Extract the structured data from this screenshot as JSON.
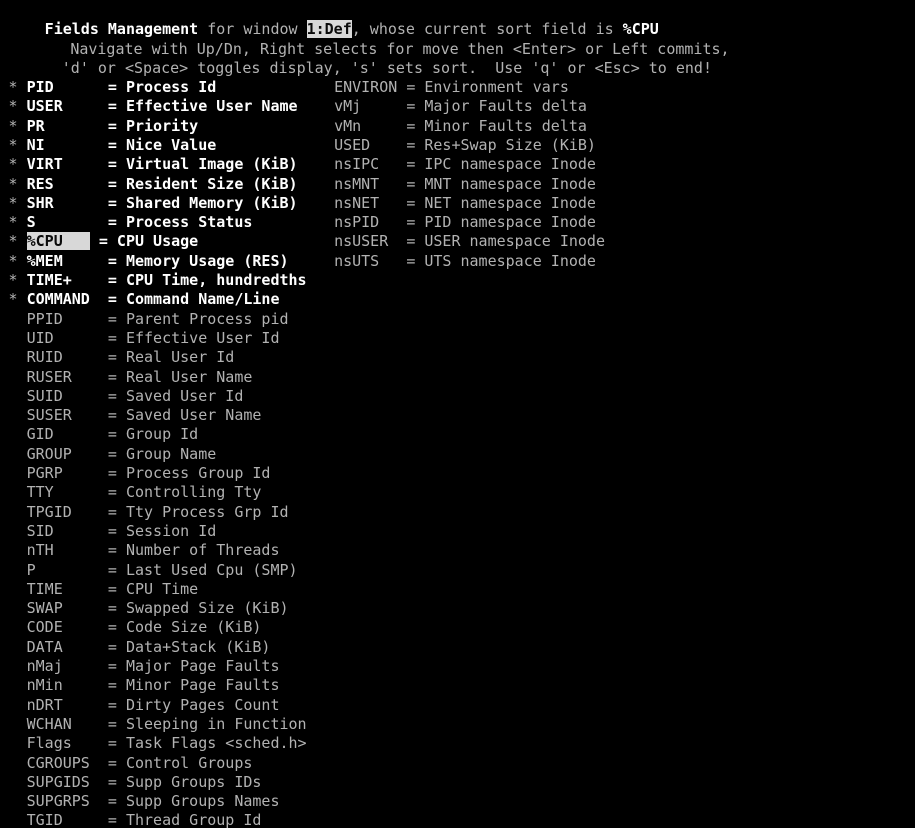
{
  "terminal": {
    "title": "Fields Management",
    "background_color": "#000000",
    "text_color": "#b2b2b2",
    "bold_color": "#ffffff",
    "highlight_bg": "#d8d8d8",
    "highlight_fg": "#0b0b0b"
  },
  "header": {
    "line1": {
      "title": "Fields Management",
      "for_window": " for window ",
      "window_value": "1:Def",
      "whose": ", whose current sort field is ",
      "sort_field": "%CPU"
    },
    "line2": "Navigate with Up/Dn, Right selects for move then <Enter> or Left commits,",
    "line3": "'d' or <Space> toggles display, 's' sets sort.  Use 'q' or <Esc> to end!"
  },
  "left_column": [
    {
      "marker": "*",
      "name": "PID",
      "desc": "Process Id",
      "on": true,
      "selected": false
    },
    {
      "marker": "*",
      "name": "USER",
      "desc": "Effective User Name",
      "on": true,
      "selected": false
    },
    {
      "marker": "*",
      "name": "PR",
      "desc": "Priority",
      "on": true,
      "selected": false
    },
    {
      "marker": "*",
      "name": "NI",
      "desc": "Nice Value",
      "on": true,
      "selected": false
    },
    {
      "marker": "*",
      "name": "VIRT",
      "desc": "Virtual Image (KiB)",
      "on": true,
      "selected": false
    },
    {
      "marker": "*",
      "name": "RES",
      "desc": "Resident Size (KiB)",
      "on": true,
      "selected": false
    },
    {
      "marker": "*",
      "name": "SHR",
      "desc": "Shared Memory (KiB)",
      "on": true,
      "selected": false
    },
    {
      "marker": "*",
      "name": "S",
      "desc": "Process Status",
      "on": true,
      "selected": false
    },
    {
      "marker": "*",
      "name": "%CPU",
      "desc": "CPU Usage",
      "on": true,
      "selected": true
    },
    {
      "marker": "*",
      "name": "%MEM",
      "desc": "Memory Usage (RES)",
      "on": true,
      "selected": false
    },
    {
      "marker": "*",
      "name": "TIME+",
      "desc": "CPU Time, hundredths",
      "on": true,
      "selected": false
    },
    {
      "marker": "*",
      "name": "COMMAND",
      "desc": "Command Name/Line",
      "on": true,
      "selected": false
    },
    {
      "marker": " ",
      "name": "PPID",
      "desc": "Parent Process pid",
      "on": false,
      "selected": false
    },
    {
      "marker": " ",
      "name": "UID",
      "desc": "Effective User Id",
      "on": false,
      "selected": false
    },
    {
      "marker": " ",
      "name": "RUID",
      "desc": "Real User Id",
      "on": false,
      "selected": false
    },
    {
      "marker": " ",
      "name": "RUSER",
      "desc": "Real User Name",
      "on": false,
      "selected": false
    },
    {
      "marker": " ",
      "name": "SUID",
      "desc": "Saved User Id",
      "on": false,
      "selected": false
    },
    {
      "marker": " ",
      "name": "SUSER",
      "desc": "Saved User Name",
      "on": false,
      "selected": false
    },
    {
      "marker": " ",
      "name": "GID",
      "desc": "Group Id",
      "on": false,
      "selected": false
    },
    {
      "marker": " ",
      "name": "GROUP",
      "desc": "Group Name",
      "on": false,
      "selected": false
    },
    {
      "marker": " ",
      "name": "PGRP",
      "desc": "Process Group Id",
      "on": false,
      "selected": false
    },
    {
      "marker": " ",
      "name": "TTY",
      "desc": "Controlling Tty",
      "on": false,
      "selected": false
    },
    {
      "marker": " ",
      "name": "TPGID",
      "desc": "Tty Process Grp Id",
      "on": false,
      "selected": false
    },
    {
      "marker": " ",
      "name": "SID",
      "desc": "Session Id",
      "on": false,
      "selected": false
    },
    {
      "marker": " ",
      "name": "nTH",
      "desc": "Number of Threads",
      "on": false,
      "selected": false
    },
    {
      "marker": " ",
      "name": "P",
      "desc": "Last Used Cpu (SMP)",
      "on": false,
      "selected": false
    },
    {
      "marker": " ",
      "name": "TIME",
      "desc": "CPU Time",
      "on": false,
      "selected": false
    },
    {
      "marker": " ",
      "name": "SWAP",
      "desc": "Swapped Size (KiB)",
      "on": false,
      "selected": false
    },
    {
      "marker": " ",
      "name": "CODE",
      "desc": "Code Size (KiB)",
      "on": false,
      "selected": false
    },
    {
      "marker": " ",
      "name": "DATA",
      "desc": "Data+Stack (KiB)",
      "on": false,
      "selected": false
    },
    {
      "marker": " ",
      "name": "nMaj",
      "desc": "Major Page Faults",
      "on": false,
      "selected": false
    },
    {
      "marker": " ",
      "name": "nMin",
      "desc": "Minor Page Faults",
      "on": false,
      "selected": false
    },
    {
      "marker": " ",
      "name": "nDRT",
      "desc": "Dirty Pages Count",
      "on": false,
      "selected": false
    },
    {
      "marker": " ",
      "name": "WCHAN",
      "desc": "Sleeping in Function",
      "on": false,
      "selected": false
    },
    {
      "marker": " ",
      "name": "Flags",
      "desc": "Task Flags <sched.h>",
      "on": false,
      "selected": false
    },
    {
      "marker": " ",
      "name": "CGROUPS",
      "desc": "Control Groups",
      "on": false,
      "selected": false
    },
    {
      "marker": " ",
      "name": "SUPGIDS",
      "desc": "Supp Groups IDs",
      "on": false,
      "selected": false
    },
    {
      "marker": " ",
      "name": "SUPGRPS",
      "desc": "Supp Groups Names",
      "on": false,
      "selected": false
    },
    {
      "marker": " ",
      "name": "TGID",
      "desc": "Thread Group Id",
      "on": false,
      "selected": false
    }
  ],
  "right_column": [
    {
      "marker": " ",
      "name": "ENVIRON",
      "desc": "Environment vars",
      "on": false,
      "selected": false
    },
    {
      "marker": " ",
      "name": "vMj",
      "desc": "Major Faults delta",
      "on": false,
      "selected": false
    },
    {
      "marker": " ",
      "name": "vMn",
      "desc": "Minor Faults delta",
      "on": false,
      "selected": false
    },
    {
      "marker": " ",
      "name": "USED",
      "desc": "Res+Swap Size (KiB)",
      "on": false,
      "selected": false
    },
    {
      "marker": " ",
      "name": "nsIPC",
      "desc": "IPC namespace Inode",
      "on": false,
      "selected": false
    },
    {
      "marker": " ",
      "name": "nsMNT",
      "desc": "MNT namespace Inode",
      "on": false,
      "selected": false
    },
    {
      "marker": " ",
      "name": "nsNET",
      "desc": "NET namespace Inode",
      "on": false,
      "selected": false
    },
    {
      "marker": " ",
      "name": "nsPID",
      "desc": "PID namespace Inode",
      "on": false,
      "selected": false
    },
    {
      "marker": " ",
      "name": "nsUSER",
      "desc": "USER namespace Inode",
      "on": false,
      "selected": false
    },
    {
      "marker": " ",
      "name": "nsUTS",
      "desc": "UTS namespace Inode",
      "on": false,
      "selected": false
    }
  ]
}
